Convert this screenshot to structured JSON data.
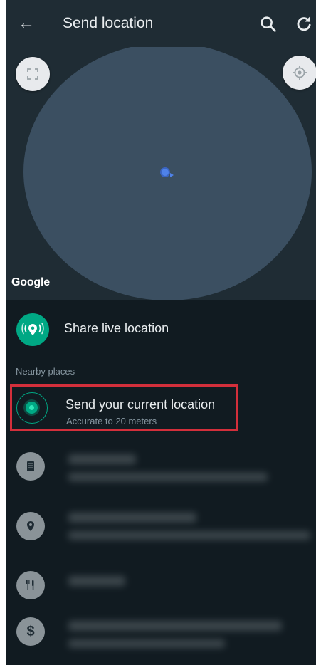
{
  "appbar": {
    "title": "Send location",
    "back_icon": "arrow-left-icon",
    "search_icon": "search-icon",
    "refresh_icon": "refresh-icon"
  },
  "map": {
    "watermark": "Google",
    "fullscreen_icon": "fullscreen-icon",
    "my_location_icon": "my-location-icon"
  },
  "share_live": {
    "label": "Share live location",
    "icon": "live-location-icon"
  },
  "nearby": {
    "header": "Nearby places",
    "current": {
      "title": "Send your current location",
      "subtitle": "Accurate to 20 meters",
      "icon": "current-location-icon"
    },
    "places": [
      {
        "icon": "building-icon"
      },
      {
        "icon": "pin-icon"
      },
      {
        "icon": "restaurant-icon"
      },
      {
        "icon": "dollar-icon"
      }
    ]
  },
  "colors": {
    "accent": "#00a884",
    "highlight": "#d32f3b",
    "background": "#111b21",
    "bar": "#1f2c34"
  }
}
